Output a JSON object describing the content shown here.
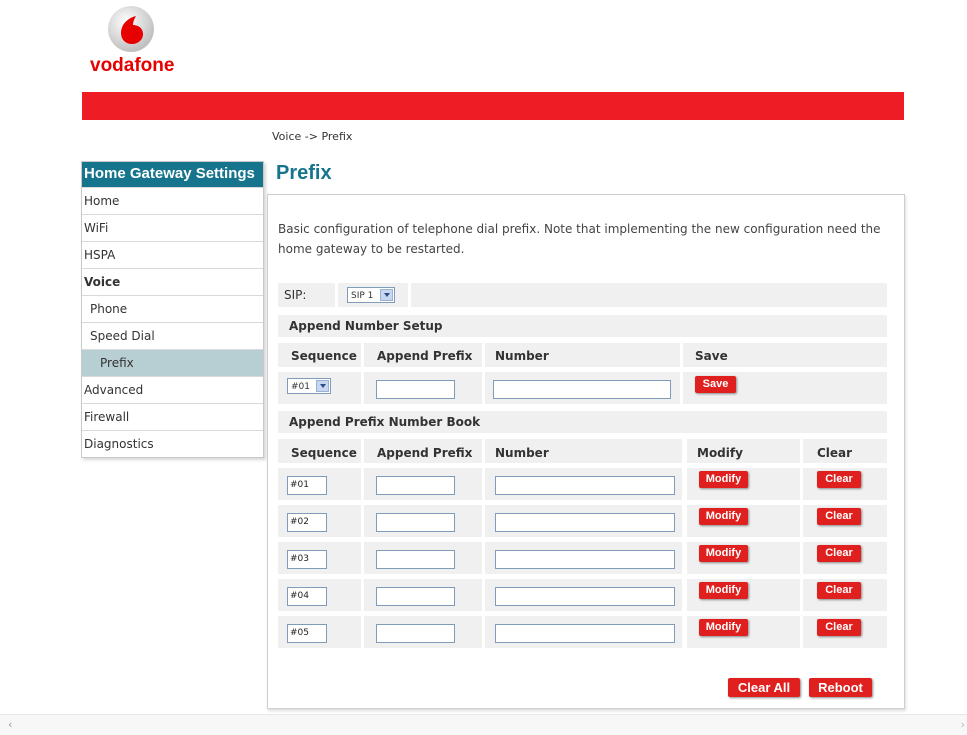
{
  "brand": {
    "name": "vodafone",
    "accent": "#ee1c25",
    "teal": "#16758c"
  },
  "breadcrumb": "Voice -> Prefix",
  "sidebar": {
    "title": "Home Gateway Settings",
    "items": [
      {
        "label": "Home"
      },
      {
        "label": "WiFi"
      },
      {
        "label": "HSPA"
      },
      {
        "label": "Voice"
      },
      {
        "label": "Phone"
      },
      {
        "label": "Speed Dial"
      },
      {
        "label": "Prefix"
      },
      {
        "label": "Advanced"
      },
      {
        "label": "Firewall"
      },
      {
        "label": "Diagnostics"
      }
    ]
  },
  "page": {
    "title": "Prefix",
    "description": "Basic configuration of telephone dial prefix. Note that implementing the new configuration need the home gateway to be restarted."
  },
  "sip": {
    "label": "SIP:",
    "value": "SIP 1"
  },
  "setup": {
    "title": "Append Number Setup",
    "headers": {
      "sequence": "Sequence",
      "append_prefix": "Append Prefix",
      "number": "Number",
      "save": "Save"
    },
    "sequence_value": "#01",
    "append_prefix_value": "",
    "number_value": "",
    "save_button": "Save"
  },
  "book": {
    "title": "Append Prefix Number Book",
    "headers": {
      "sequence": "Sequence",
      "append_prefix": "Append Prefix",
      "number": "Number",
      "modify": "Modify",
      "clear": "Clear"
    },
    "rows": [
      {
        "sequence": "#01",
        "append_prefix": "",
        "number": "",
        "modify": "Modify",
        "clear": "Clear"
      },
      {
        "sequence": "#02",
        "append_prefix": "",
        "number": "",
        "modify": "Modify",
        "clear": "Clear"
      },
      {
        "sequence": "#03",
        "append_prefix": "",
        "number": "",
        "modify": "Modify",
        "clear": "Clear"
      },
      {
        "sequence": "#04",
        "append_prefix": "",
        "number": "",
        "modify": "Modify",
        "clear": "Clear"
      },
      {
        "sequence": "#05",
        "append_prefix": "",
        "number": "",
        "modify": "Modify",
        "clear": "Clear"
      }
    ]
  },
  "footer": {
    "clear_all": "Clear All",
    "reboot": "Reboot"
  }
}
